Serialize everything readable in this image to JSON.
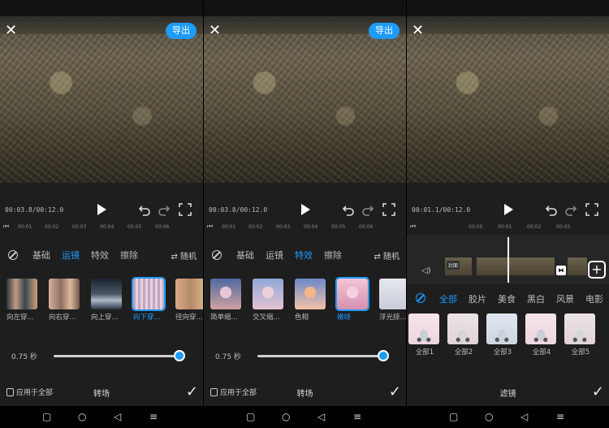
{
  "colors": {
    "accent": "#1e9bff",
    "background": "#1e1e1e"
  },
  "panels": [
    {
      "export_label": "导出",
      "time": "00:03.8/00:12.0",
      "ruler_ticks": [
        "00:01",
        "00:02",
        "00:03",
        "00:04",
        "00:05",
        "00:06"
      ],
      "categories": [
        "基础",
        "运镜",
        "特效",
        "擦除"
      ],
      "active_category": "运镜",
      "random_label": "随机",
      "items": [
        "向左穿...",
        "向右穿...",
        "向上穿...",
        "向下穿...",
        "径向穿..."
      ],
      "selected_item": "向下穿...",
      "duration": "0.75 秒",
      "duration_fraction": 1.0,
      "apply_all": "应用于全部",
      "title": "转场"
    },
    {
      "export_label": "导出",
      "time": "00:03.8/00:12.0",
      "ruler_ticks": [
        "00:01",
        "00:02",
        "00:03",
        "00:04",
        "00:05",
        "00:06"
      ],
      "categories": [
        "基础",
        "运镜",
        "特效",
        "擦除"
      ],
      "active_category": "特效",
      "random_label": "随机",
      "items": [
        "简单缩...",
        "交叉缩...",
        "色相",
        "嫩绕",
        "浮光掠..."
      ],
      "selected_item": "嫩绕",
      "duration": "0.75 秒",
      "duration_fraction": 1.0,
      "apply_all": "应用于全部",
      "title": "转场"
    },
    {
      "time": "00:01.1/00:12.0",
      "ruler_ticks": [
        "00:00",
        "00:01",
        "00:02",
        "00:03"
      ],
      "cover_label": "封面",
      "filter_categories": [
        "全部",
        "胶片",
        "美食",
        "黑白",
        "风景",
        "电影"
      ],
      "active_filter_category": "全部",
      "filters": [
        "全部1",
        "全部2",
        "全部3",
        "全部4",
        "全部5"
      ],
      "title": "滤镜"
    }
  ],
  "nav": {
    "recent": "recents-square-icon",
    "home": "home-circle-icon",
    "back": "back-triangle-icon",
    "menu": "menu-lines-icon"
  }
}
